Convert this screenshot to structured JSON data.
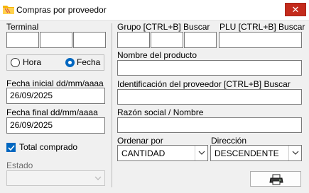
{
  "window": {
    "title": "Compras por proveedor",
    "close_glyph": "✕"
  },
  "left": {
    "terminal_label": "Terminal",
    "radio_hora": "Hora",
    "radio_fecha": "Fecha",
    "radio_selected": "Fecha",
    "fecha_inicial_label": "Fecha inicial dd/mm/aaaa",
    "fecha_inicial_value": "26/09/2025",
    "fecha_final_label": "Fecha final dd/mm/aaaa",
    "fecha_final_value": "26/09/2025",
    "total_comprado_label": "Total comprado",
    "total_comprado_checked": true,
    "estado_label": "Estado",
    "estado_value": ""
  },
  "right": {
    "grupo_label": "Grupo [CTRL+B] Buscar",
    "plu_label": "PLU [CTRL+B] Buscar",
    "nombre_producto_label": "Nombre del producto",
    "id_proveedor_label": "Identificación del proveedor [CTRL+B] Buscar",
    "razon_social_label": "Razón social / Nombre",
    "ordenar_label": "Ordenar por",
    "ordenar_value": "CANTIDAD",
    "direccion_label": "Dirección",
    "direccion_value": "DESCENDENTE"
  },
  "icons": {
    "app": "folder-app-icon",
    "print": "printer-icon"
  },
  "colors": {
    "accent": "#0067c0",
    "close": "#c42b1c"
  }
}
